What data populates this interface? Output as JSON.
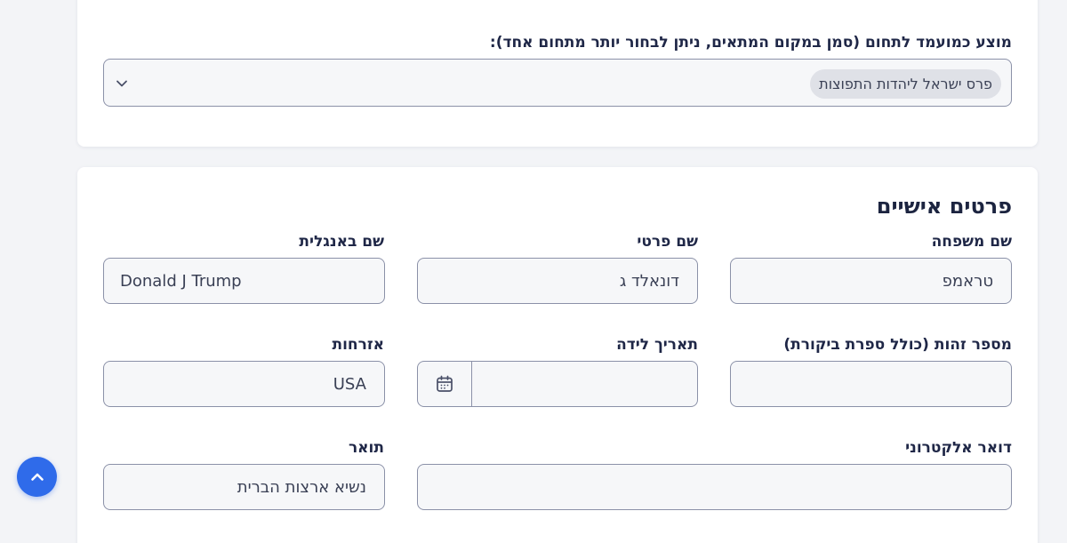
{
  "top_section": {
    "recommendation_label": "מוצע כמועמד לתחום (סמן במקום המתאים, ניתן לבחור יותר מתחום אחד):",
    "selected_tags": [
      "פרס ישראל ליהדות התפוצות"
    ]
  },
  "personal": {
    "title": "פרטים אישיים",
    "fields": {
      "last_name": {
        "label": "שם משפחה",
        "value": "טראמפ"
      },
      "first_name": {
        "label": "שם פרטי",
        "value": "דונאלד ג"
      },
      "english_name": {
        "label": "שם באנגלית",
        "value": "Donald J Trump"
      },
      "id_number": {
        "label": "מספר זהות (כולל ספרת ביקורת)",
        "value": ""
      },
      "birth_date": {
        "label": "תאריך לידה",
        "value": ""
      },
      "citizenship": {
        "label": "אזרחות",
        "value": "USA"
      },
      "email": {
        "label": "דואר אלקטרוני",
        "value": ""
      },
      "degree": {
        "label": "תואר",
        "value": "נשיא ארצות הברית"
      }
    }
  },
  "icons": {
    "chevron": "chevron-down-icon",
    "calendar": "calendar-icon",
    "scroll_top": "chevron-up-icon"
  },
  "colors": {
    "accent": "#2f6bea",
    "background": "#f3f4f7",
    "card": "#ffffff",
    "border": "#8b91a8",
    "text": "#1c2440"
  }
}
